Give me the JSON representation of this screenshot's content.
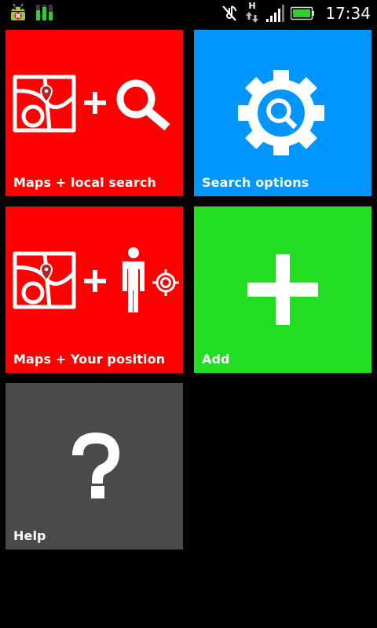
{
  "status_bar": {
    "time": "17:34",
    "network_type": "H",
    "icons": [
      "android-debug-icon",
      "equalizer-icon",
      "mute-icon",
      "data-transfer-icon",
      "signal-icon",
      "battery-icon"
    ]
  },
  "tiles": [
    {
      "id": "maps-search",
      "label": "Maps + local search",
      "color": "#ff0000",
      "icon": "map-plus-search-icon"
    },
    {
      "id": "search-options",
      "label": "Search options",
      "color": "#0096ff",
      "icon": "gear-search-icon"
    },
    {
      "id": "maps-position",
      "label": "Maps + Your position",
      "color": "#ff0000",
      "icon": "map-plus-person-icon"
    },
    {
      "id": "add",
      "label": "Add",
      "color": "#22dd22",
      "icon": "plus-icon"
    },
    {
      "id": "help",
      "label": "Help",
      "color": "#4a4a4a",
      "icon": "question-mark-icon"
    }
  ]
}
